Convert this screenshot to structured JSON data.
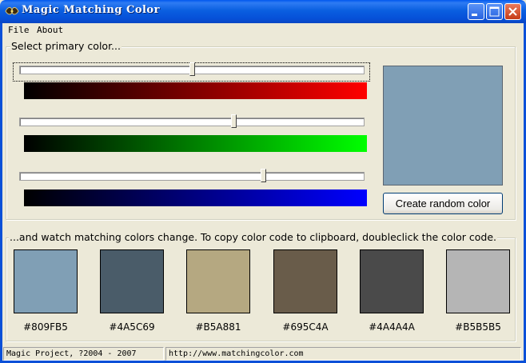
{
  "window": {
    "title": "Magic Matching Color",
    "title_bar_color": "#0A5FE0"
  },
  "menu": {
    "items": [
      "File",
      "About"
    ]
  },
  "primary": {
    "group_label": "Select primary color...",
    "sliders": [
      {
        "channel": "red",
        "value": 128,
        "max": 255,
        "gradient_end": "#FF0000"
      },
      {
        "channel": "green",
        "value": 159,
        "max": 255,
        "gradient_end": "#00FF00"
      },
      {
        "channel": "blue",
        "value": 181,
        "max": 255,
        "gradient_end": "#0000FF"
      }
    ],
    "preview_color": "#809FB5",
    "random_button_label": "Create random color"
  },
  "matching": {
    "group_label": "...and watch matching colors change. To copy color code to clipboard, doubleclick the color code.",
    "swatches": [
      {
        "color": "#809FB5",
        "code": "#809FB5"
      },
      {
        "color": "#4A5C69",
        "code": "#4A5C69"
      },
      {
        "color": "#B5A881",
        "code": "#B5A881"
      },
      {
        "color": "#695C4A",
        "code": "#695C4A"
      },
      {
        "color": "#4A4A4A",
        "code": "#4A4A4A"
      },
      {
        "color": "#B5B5B5",
        "code": "#B5B5B5"
      }
    ]
  },
  "status_bar": {
    "copyright": "Magic Project, ?2004 - 2007",
    "url": "http://www.matchingcolor.com"
  }
}
